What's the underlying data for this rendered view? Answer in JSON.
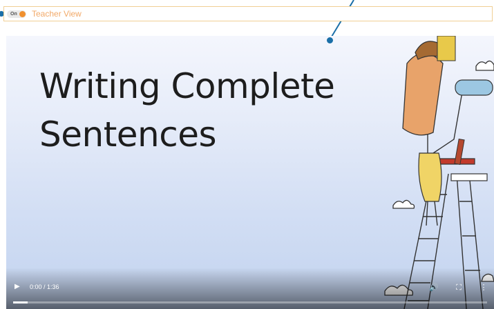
{
  "teacher_view": {
    "toggle_label": "On",
    "label": "Teacher View",
    "enabled": true
  },
  "video": {
    "title_line1": "Writing Complete",
    "title_line2": "Sentences",
    "time_display": "0:00 / 1:36",
    "progress_fraction": 0.03,
    "icons": [
      "play-icon",
      "volume-icon",
      "fullscreen-icon",
      "more-options-icon"
    ]
  },
  "colors": {
    "annotation": "#1a6fa8",
    "toggle_knob": "#f0902f",
    "teacher_view_text": "#f2a968"
  }
}
